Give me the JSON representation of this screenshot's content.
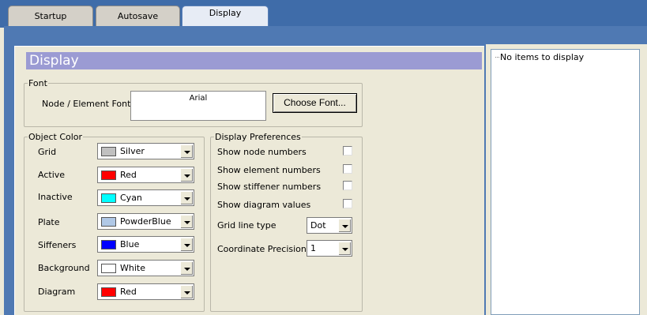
{
  "tabs": [
    {
      "label": "Startup"
    },
    {
      "label": "Autosave"
    },
    {
      "label": "Display"
    }
  ],
  "header": {
    "title": "Display"
  },
  "font_group": {
    "legend": "Font",
    "label": "Node / Element Font",
    "preview": "Arial",
    "choose_button": "Choose Font..."
  },
  "object_color": {
    "legend": "Object Color",
    "rows": [
      {
        "label": "Grid",
        "value": "Silver",
        "color": "#c0c0c0"
      },
      {
        "label": "Active",
        "value": "Red",
        "color": "#ff0000"
      },
      {
        "label": "Inactive",
        "value": "Cyan",
        "color": "#00ffff"
      },
      {
        "label": "Plate",
        "value": "PowderBlue",
        "color": "#b0c8e6"
      },
      {
        "label": "Siffeners",
        "value": "Blue",
        "color": "#0000ff"
      },
      {
        "label": "Background",
        "value": "White",
        "color": "#ffffff"
      },
      {
        "label": "Diagram",
        "value": "Red",
        "color": "#ff0000"
      }
    ]
  },
  "display_prefs": {
    "legend": "Display Preferences",
    "checks": [
      {
        "label": "Show node numbers",
        "checked": false
      },
      {
        "label": "Show element numbers",
        "checked": false
      },
      {
        "label": "Show stiffener numbers",
        "checked": false
      },
      {
        "label": "Show diagram values",
        "checked": false
      }
    ],
    "grid_line_type": {
      "label": "Grid line type",
      "value": "Dot"
    },
    "coord_precision": {
      "label": "Coordinate Precision",
      "value": "1"
    }
  },
  "list": {
    "empty_text": "No items to display"
  }
}
